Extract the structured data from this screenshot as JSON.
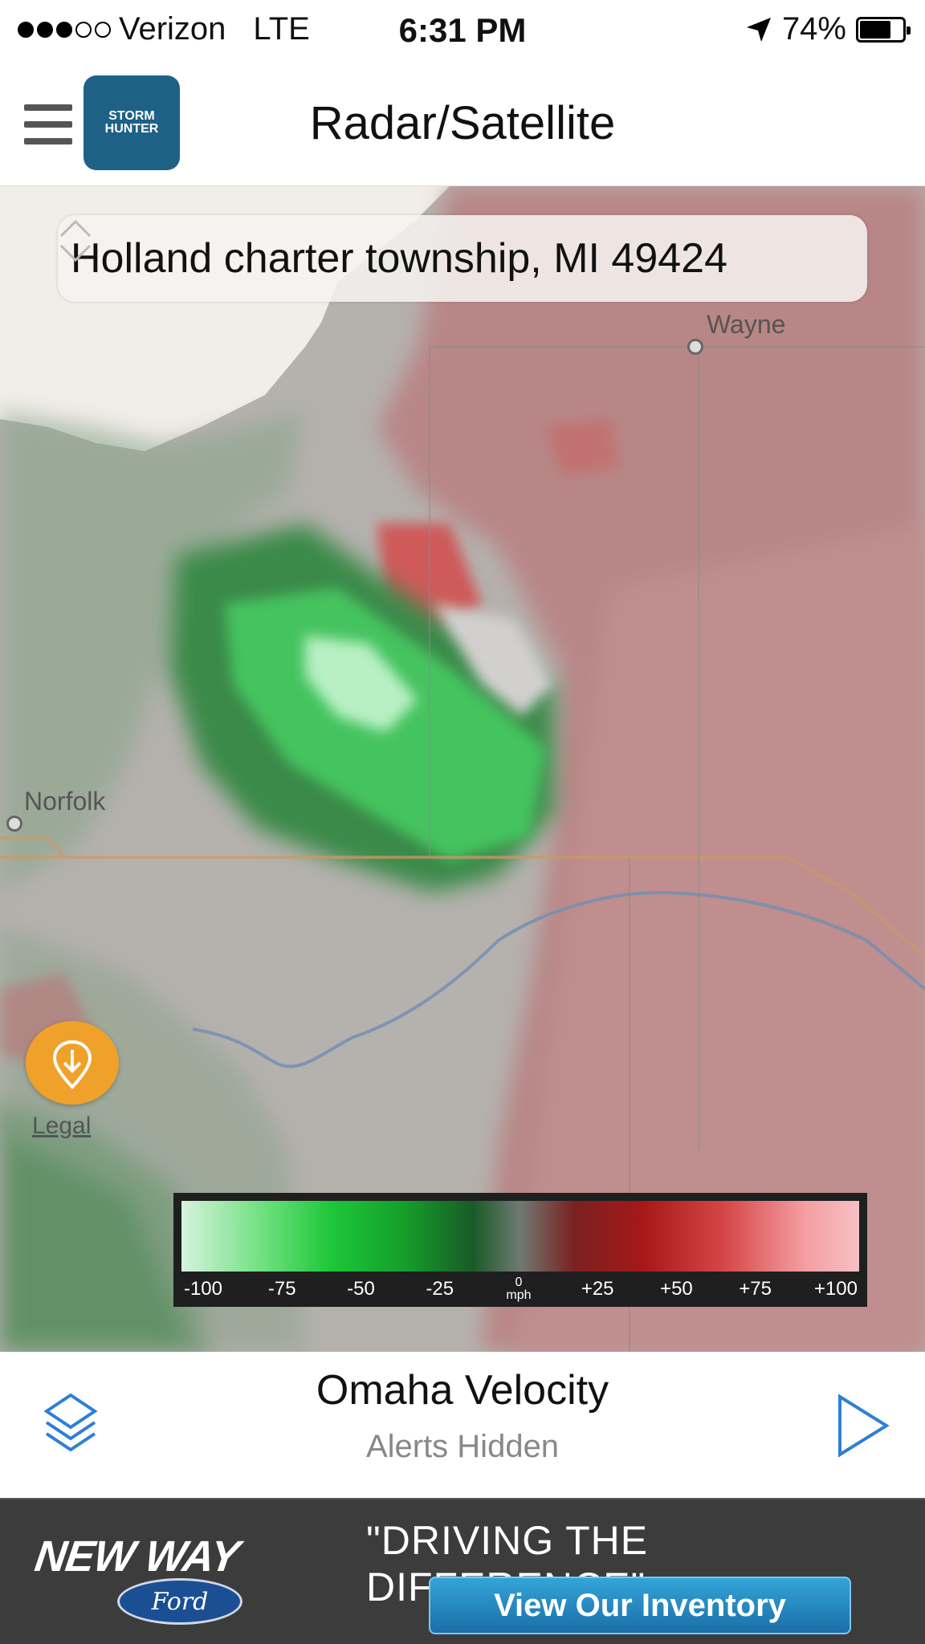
{
  "status_bar": {
    "carrier": "Verizon",
    "network": "LTE",
    "time": "6:31 PM",
    "battery": "74%",
    "battery_level": 0.74,
    "signal_bars": 3,
    "signal_max": 5
  },
  "header": {
    "title": "Radar/Satellite",
    "logo_text": "STORM HUNTER"
  },
  "map": {
    "search_value": "Holland charter township, MI 49424",
    "places": {
      "wayne": "Wayne",
      "norfolk": "Norfolk"
    },
    "legal_label": "Legal"
  },
  "legend": {
    "ticks": [
      "-100",
      "-75",
      "-50",
      "-25",
      "0",
      "+25",
      "+50",
      "+75",
      "+100"
    ],
    "unit": "mph"
  },
  "bottom_bar": {
    "radar_name": "Omaha Velocity",
    "alerts_status": "Alerts Hidden"
  },
  "ad": {
    "brand": "NEW WAY",
    "ford": "Ford",
    "tagline": "\"DRIVING THE DIFFERENCE\"",
    "cta": "View Our Inventory"
  },
  "colors": {
    "accent_blue": "#2e7fd6",
    "legal_orange": "#f0a12a",
    "logo_blue": "#1e6186"
  },
  "icons": [
    "menu-icon",
    "location-arrow-icon",
    "battery-icon",
    "stepper-icon",
    "download-pin-icon",
    "layers-icon",
    "play-icon"
  ]
}
